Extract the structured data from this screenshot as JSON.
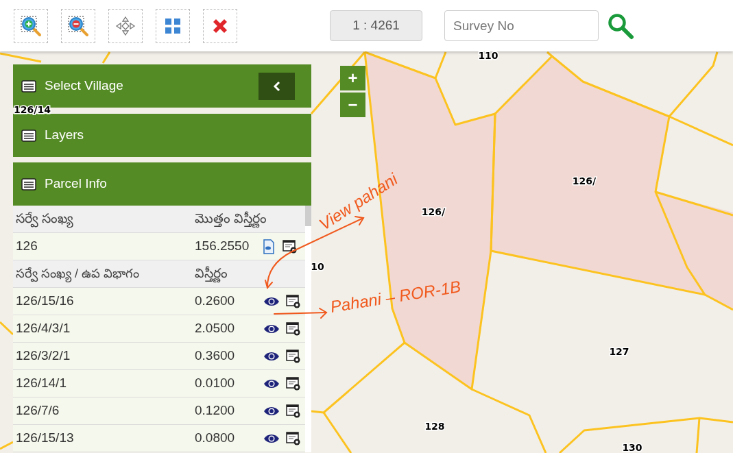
{
  "toolbar": {
    "scale": "1 : 4261",
    "search": {
      "placeholder": "Survey No"
    }
  },
  "panels": [
    {
      "title": "Select Village",
      "collapse_button": true
    },
    {
      "title": "Layers",
      "collapse_button": false
    },
    {
      "title": "Parcel Info",
      "collapse_button": false
    }
  ],
  "parcel_info": {
    "header": [
      "సర్వే సంఖ్య",
      "మొత్తం విస్తీర్ణం"
    ],
    "summary": {
      "survey_no": "126",
      "area": "156.2550"
    },
    "sub_header": [
      "సర్వే సంఖ్య / ఉప విభాగం",
      "విస్తీర్ణం"
    ],
    "rows": [
      {
        "survey_no": "126/15/16",
        "area": "0.2600"
      },
      {
        "survey_no": "126/4/3/1",
        "area": "2.0500"
      },
      {
        "survey_no": "126/3/2/1",
        "area": "0.3600"
      },
      {
        "survey_no": "126/14/1",
        "area": "0.0100"
      },
      {
        "survey_no": "126/7/6",
        "area": "0.1200"
      },
      {
        "survey_no": "126/15/13",
        "area": "0.0800"
      }
    ]
  },
  "map": {
    "zoom_controls": [
      "+",
      "−"
    ],
    "labels": [
      "110",
      "126/14",
      "126/",
      "126/",
      "10",
      "127",
      "128",
      "130"
    ]
  },
  "annotations": [
    "View pahani",
    "Pahani – ROR-1B"
  ]
}
